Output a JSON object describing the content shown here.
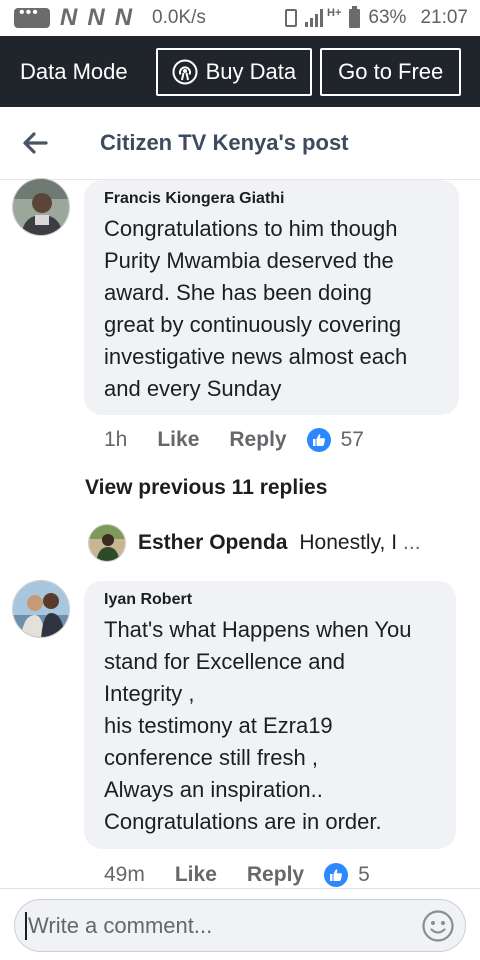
{
  "status_bar": {
    "carrier_marks": [
      "N",
      "N",
      "N"
    ],
    "speed": "0.0K/s",
    "network": "H+",
    "battery": "63%",
    "time": "21:07"
  },
  "data_bar": {
    "mode_label": "Data Mode",
    "buy_label": "Buy Data",
    "free_label": "Go to Free"
  },
  "header": {
    "title": "Citizen TV Kenya's post"
  },
  "comments": [
    {
      "author": "Francis Kiongera Giathi",
      "text": "Congratulations to him though\nPurity Mwambia deserved the\naward. She has been doing\ngreat by continuously covering\ninvestigative news almost each\nand every Sunday",
      "time": "1h",
      "like_label": "Like",
      "reply_label": "Reply",
      "reaction_count": "57"
    },
    {
      "author": "Iyan Robert",
      "text": "That's what Happens when You\nstand for Excellence and\nIntegrity ,\nhis testimony at Ezra19\nconference still fresh ,\nAlways an inspiration..\nCongratulations are in order.",
      "time": "49m",
      "like_label": "Like",
      "reply_label": "Reply",
      "reaction_count": "5"
    }
  ],
  "replies": {
    "view_previous_label": "View previous 11 replies",
    "latest": {
      "author": "Esther Openda",
      "snippet": "Honestly, I",
      "ellipsis": "..."
    }
  },
  "composer": {
    "placeholder": "Write a comment..."
  },
  "colors": {
    "banner_bg": "#20252b",
    "bubble_bg": "#f0f2f5",
    "like_blue": "#2d88ff",
    "title_color": "#3c4b5e"
  }
}
